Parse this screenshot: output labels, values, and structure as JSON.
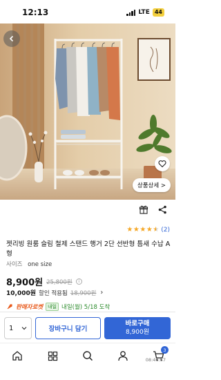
{
  "status_bar": {
    "time": "12:13",
    "network": "LTE",
    "battery": "44"
  },
  "product": {
    "title": "젯리빙 원룸 슬림 철제 스탠드 행거 2단 선반형 틈새 수납 A형",
    "option_label": "사이즈",
    "option_value": "one size",
    "review_count": "(2)",
    "rating": 4.5,
    "detail_button": "상품상세 >"
  },
  "pricing": {
    "price": "8,900원",
    "original_price": "25,800원",
    "coupon_price": "10,000원",
    "coupon_text": "할인 적용됨",
    "coupon_original": "18,900원"
  },
  "delivery": {
    "rocket": "판매자로켓",
    "badge": "내일",
    "date": "내일(월) 5/18 도착"
  },
  "purchase": {
    "quantity": "1",
    "cart_button": "장바구니 담기",
    "buy_button": "바로구매",
    "buy_price": "8,900원"
  },
  "nav": {
    "cart_count": "3",
    "clock": "08:46:57"
  },
  "colors": {
    "accent": "#3266d6",
    "star": "#f5a623",
    "delivery_green": "#2a8a2a",
    "rocket_orange": "#e85a1c"
  }
}
